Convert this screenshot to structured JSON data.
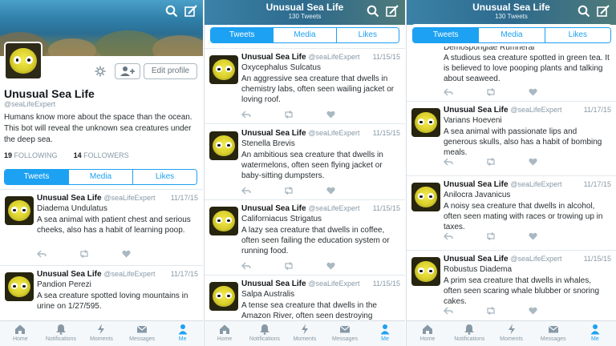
{
  "header": {
    "title": "Unusual Sea Life",
    "subtitle": "130 Tweets"
  },
  "profile": {
    "name": "Unusual Sea Life",
    "handle": "@seaLifeExpert",
    "bio": "Humans know more about the space than the ocean. This bot will reveal the unknown sea creatures under the deep sea.",
    "following_count": "19",
    "following_label": "FOLLOWING",
    "followers_count": "14",
    "followers_label": "FOLLOWERS",
    "edit_profile_label": "Edit profile"
  },
  "tabs": [
    "Tweets",
    "Media",
    "Likes"
  ],
  "tweet_name": "Unusual Sea Life",
  "tweet_handle": "@seaLifeExpert",
  "panel1_tweets": [
    {
      "date": "11/17/15",
      "species": "Diadema Undulatus",
      "text": "A sea animal with patient chest and serious cheeks, also has a habit of learning poop."
    },
    {
      "date": "11/17/15",
      "species": "Pandion Perezi",
      "text": "A sea creature spotted loving mountains in urine on 1/27/595."
    }
  ],
  "panel2_tweets": [
    {
      "date": "11/15/15",
      "species": "Oxycephalus Sulcatus",
      "text": "An aggressive sea creature that dwells in chemistry labs, often seen wailing jacket or loving roof."
    },
    {
      "date": "11/15/15",
      "species": "Stenella Brevis",
      "text": "An ambitious sea creature that dwells in watermelons, often seen flying jacket or baby-sitting dumpsters."
    },
    {
      "date": "11/15/15",
      "species": "Californiacus Strigatus",
      "text": "A lazy sea creature that dwells in coffee, often seen failing the education system or running food."
    },
    {
      "date": "11/15/15",
      "species": "Salpa Australis",
      "text": "A tense sea creature that dwells in the Amazon River, often seen destroying"
    }
  ],
  "panel3_tweets": [
    {
      "date": "",
      "species": "Demospongiae Rumnerai",
      "text": "A studious sea creature spotted in green tea. It is believed to love pooping plants and talking about seaweed."
    },
    {
      "date": "11/17/15",
      "species": "Varians Hoeveni",
      "text": "A sea animal with passionate lips and generous skulls, also has a habit of bombing meals."
    },
    {
      "date": "11/17/15",
      "species": "Anilocra Javanicus",
      "text": "A noisy sea creature that dwells in alcohol, often seen mating with races or trowing up in taxes."
    },
    {
      "date": "11/15/15",
      "species": "Robustus Diadema",
      "text": "A prim sea creature that dwells in whales, often seen scaring whale blubber or snoring cakes."
    }
  ],
  "nav": [
    "Home",
    "Notifications",
    "Moments",
    "Messages",
    "Me"
  ],
  "colors": {
    "accent": "#1da1f2",
    "muted": "#8899a6"
  }
}
